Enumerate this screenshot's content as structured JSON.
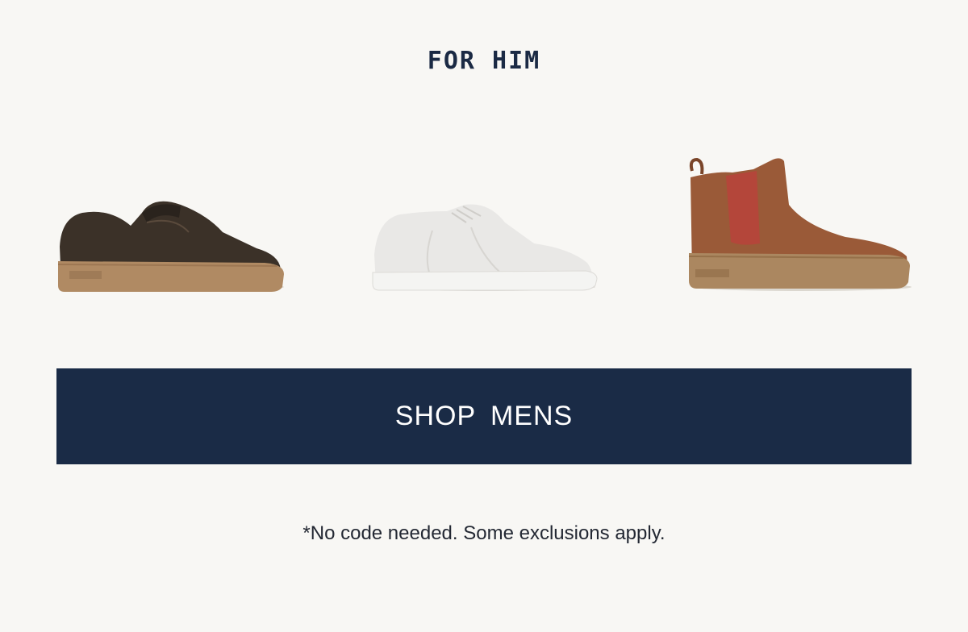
{
  "section": {
    "heading": "FOR HIM"
  },
  "products": [
    {
      "icon": "slip-on-sneaker-icon",
      "color": "#3b3128",
      "sole_color": "#b08a63"
    },
    {
      "icon": "white-lace-up-sneaker-icon",
      "color": "#e9e8e6",
      "sole_color": "#f4f4f2"
    },
    {
      "icon": "chelsea-boot-icon",
      "color": "#9a5a38",
      "sole_color": "#ab8760"
    }
  ],
  "cta": {
    "label": "SHOP MENS",
    "background": "#1a2b46"
  },
  "disclaimer": "*No code needed. Some exclusions apply.",
  "colors": {
    "page_background": "#f8f7f4",
    "heading": "#1b2a44",
    "cta_text": "#ffffff"
  }
}
